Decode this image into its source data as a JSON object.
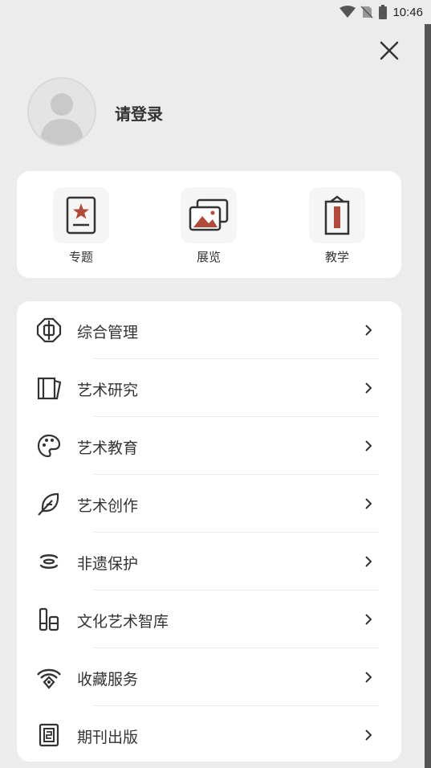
{
  "status_bar": {
    "time": "10:46"
  },
  "profile": {
    "login_text": "请登录"
  },
  "quick_links": [
    {
      "label": "专题",
      "icon": "topic-card-icon"
    },
    {
      "label": "展览",
      "icon": "gallery-icon"
    },
    {
      "label": "教学",
      "icon": "teaching-icon"
    }
  ],
  "menu": [
    {
      "label": "综合管理",
      "icon": "management-icon"
    },
    {
      "label": "艺术研究",
      "icon": "book-icon"
    },
    {
      "label": "艺术教育",
      "icon": "palette-icon"
    },
    {
      "label": "艺术创作",
      "icon": "feather-icon"
    },
    {
      "label": "非遗保护",
      "icon": "heritage-icon"
    },
    {
      "label": "文化艺术智库",
      "icon": "think-tank-icon"
    },
    {
      "label": "收藏服务",
      "icon": "collection-icon"
    },
    {
      "label": "期刊出版",
      "icon": "journal-icon"
    }
  ],
  "colors": {
    "accent": "#b04a3a",
    "icon_stroke": "#333333",
    "background": "#ececec"
  }
}
